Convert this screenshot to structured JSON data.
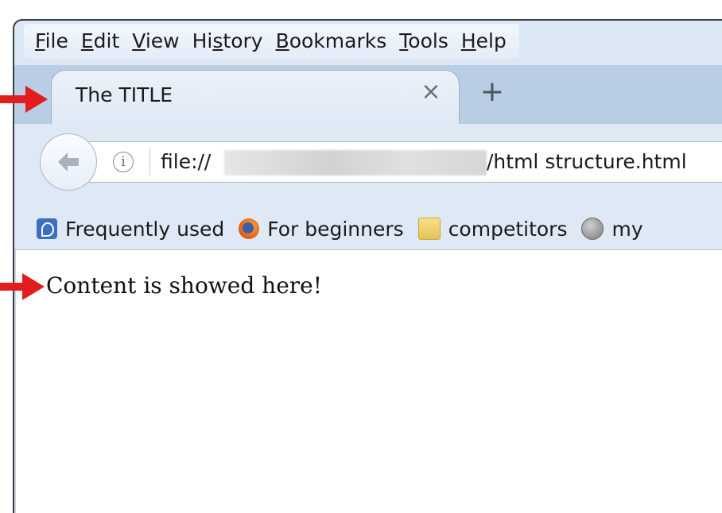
{
  "menubar": {
    "items": [
      {
        "pre": "",
        "u": "F",
        "post": "ile"
      },
      {
        "pre": "",
        "u": "E",
        "post": "dit"
      },
      {
        "pre": "",
        "u": "V",
        "post": "iew"
      },
      {
        "pre": "Hi",
        "u": "s",
        "post": "tory"
      },
      {
        "pre": "",
        "u": "B",
        "post": "ookmarks"
      },
      {
        "pre": "",
        "u": "T",
        "post": "ools"
      },
      {
        "pre": "",
        "u": "H",
        "post": "elp"
      }
    ]
  },
  "tab": {
    "title": "The TITLE",
    "close_glyph": "×",
    "new_tab_glyph": "+"
  },
  "navbar": {
    "url_prefix": "file://",
    "url_suffix": "/html structure.html",
    "info_glyph": "i"
  },
  "bookmarks": {
    "items": [
      {
        "label": "Frequently used",
        "icon": "frequently-used-icon"
      },
      {
        "label": "For beginners",
        "icon": "firefox-icon"
      },
      {
        "label": "competitors",
        "icon": "folder-icon"
      },
      {
        "label": "my",
        "icon": "globe-icon"
      }
    ]
  },
  "content": {
    "text": "Content is showed here!"
  },
  "colors": {
    "annotation_arrow": "#e11d1d",
    "chrome": "#dfe9f5",
    "tabstrip": "#b9cde4"
  }
}
